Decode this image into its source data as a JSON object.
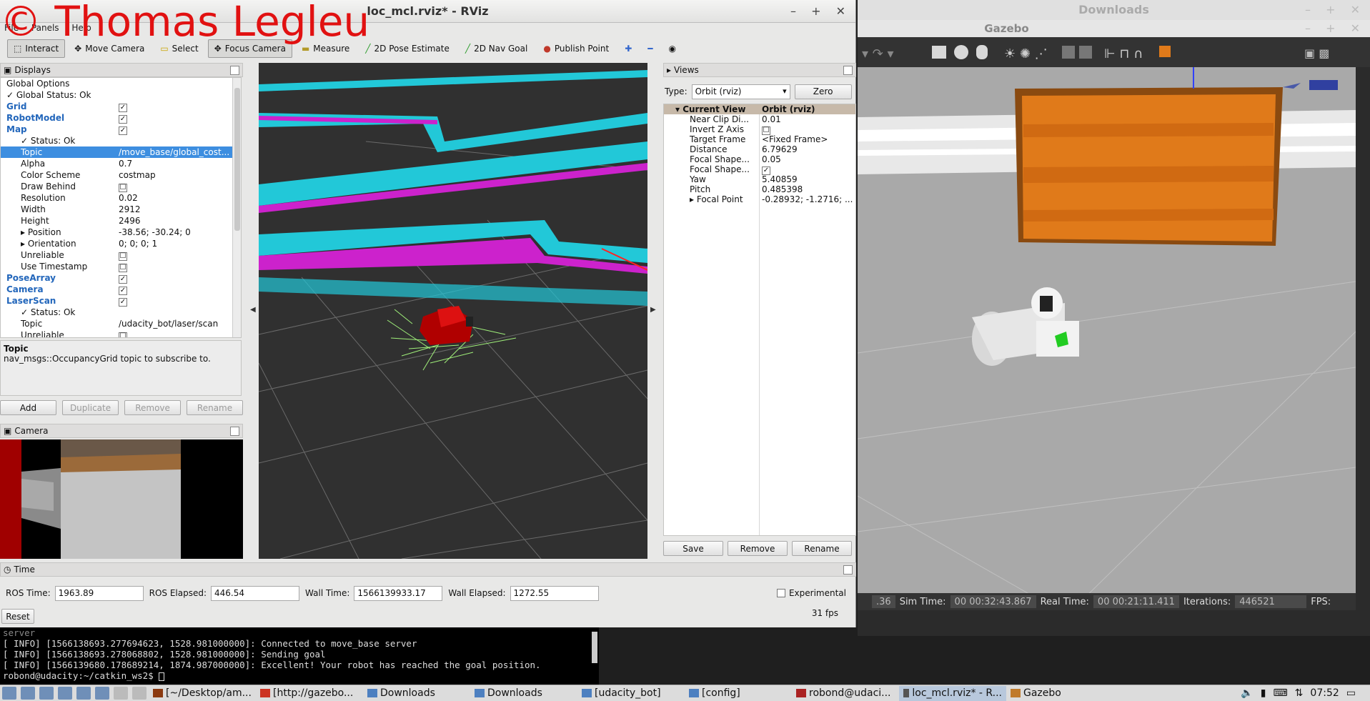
{
  "watermark": "© Thomas Legleu",
  "rviz": {
    "title": "loc_mcl.rviz* - RViz",
    "menu": [
      "File",
      "Panels",
      "Help"
    ],
    "toolbar": [
      {
        "label": "Interact",
        "icon": "cursor-icon"
      },
      {
        "label": "Move Camera",
        "icon": "move-icon"
      },
      {
        "label": "Select",
        "icon": "select-icon"
      },
      {
        "label": "Focus Camera",
        "icon": "focus-icon"
      },
      {
        "label": "Measure",
        "icon": "ruler-icon"
      },
      {
        "label": "2D Pose Estimate",
        "icon": "green-arrow-icon"
      },
      {
        "label": "2D Nav Goal",
        "icon": "green-arrow-icon"
      },
      {
        "label": "Publish Point",
        "icon": "pin-icon"
      }
    ],
    "displays": {
      "title": "Displays",
      "rows": [
        {
          "name": "Global Options",
          "val": "",
          "indent": 1,
          "style": ""
        },
        {
          "name": "Global Status: Ok",
          "val": "",
          "indent": 1,
          "style": "check"
        },
        {
          "name": "Grid",
          "val": "✓",
          "indent": 1,
          "style": "blue"
        },
        {
          "name": "RobotModel",
          "val": "✓",
          "indent": 1,
          "style": "blue"
        },
        {
          "name": "Map",
          "val": "✓",
          "indent": 1,
          "style": "blue"
        },
        {
          "name": "Status: Ok",
          "val": "",
          "indent": 2,
          "style": "check"
        },
        {
          "name": "Topic",
          "val": "/move_base/global_cost...",
          "indent": 2,
          "style": "sel"
        },
        {
          "name": "Alpha",
          "val": "0.7",
          "indent": 2,
          "style": ""
        },
        {
          "name": "Color Scheme",
          "val": "costmap",
          "indent": 2,
          "style": ""
        },
        {
          "name": "Draw Behind",
          "val": "☐",
          "indent": 2,
          "style": ""
        },
        {
          "name": "Resolution",
          "val": "0.02",
          "indent": 2,
          "style": ""
        },
        {
          "name": "Width",
          "val": "2912",
          "indent": 2,
          "style": ""
        },
        {
          "name": "Height",
          "val": "2496",
          "indent": 2,
          "style": ""
        },
        {
          "name": "Position",
          "val": "-38.56; -30.24; 0",
          "indent": 2,
          "style": "expand"
        },
        {
          "name": "Orientation",
          "val": "0; 0; 0; 1",
          "indent": 2,
          "style": "expand"
        },
        {
          "name": "Unreliable",
          "val": "☐",
          "indent": 2,
          "style": ""
        },
        {
          "name": "Use Timestamp",
          "val": "☐",
          "indent": 2,
          "style": ""
        },
        {
          "name": "PoseArray",
          "val": "✓",
          "indent": 1,
          "style": "blue"
        },
        {
          "name": "Camera",
          "val": "✓",
          "indent": 1,
          "style": "blue"
        },
        {
          "name": "LaserScan",
          "val": "✓",
          "indent": 1,
          "style": "blue"
        },
        {
          "name": "Status: Ok",
          "val": "",
          "indent": 2,
          "style": "check"
        },
        {
          "name": "Topic",
          "val": "/udacity_bot/laser/scan",
          "indent": 2,
          "style": ""
        },
        {
          "name": "Unreliable",
          "val": "☐",
          "indent": 2,
          "style": ""
        }
      ],
      "desc_title": "Topic",
      "desc_text": "nav_msgs::OccupancyGrid topic to subscribe to.",
      "buttons": {
        "add": "Add",
        "duplicate": "Duplicate",
        "remove": "Remove",
        "rename": "Rename"
      }
    },
    "camera_panel": {
      "title": "Camera"
    },
    "views": {
      "title": "Views",
      "type_label": "Type:",
      "type_value": "Orbit (rviz)",
      "zero": "Zero",
      "rows": [
        {
          "name": "Current View",
          "val": "Orbit (rviz)",
          "head": true
        },
        {
          "name": "Near Clip Di...",
          "val": "0.01"
        },
        {
          "name": "Invert Z Axis",
          "val": "☐"
        },
        {
          "name": "Target Frame",
          "val": "<Fixed Frame>"
        },
        {
          "name": "Distance",
          "val": "6.79629"
        },
        {
          "name": "Focal Shape...",
          "val": "0.05"
        },
        {
          "name": "Focal Shape...",
          "val": "✓"
        },
        {
          "name": "Yaw",
          "val": "5.40859"
        },
        {
          "name": "Pitch",
          "val": "0.485398"
        },
        {
          "name": "Focal Point",
          "val": "-0.28932; -1.2716; ..."
        }
      ],
      "buttons": {
        "save": "Save",
        "remove": "Remove",
        "rename": "Rename"
      }
    },
    "time": {
      "title": "Time",
      "ros_time_label": "ROS Time:",
      "ros_time": "1963.89",
      "ros_elapsed_label": "ROS Elapsed:",
      "ros_elapsed": "446.54",
      "wall_time_label": "Wall Time:",
      "wall_time": "1566139933.17",
      "wall_elapsed_label": "Wall Elapsed:",
      "wall_elapsed": "1272.55",
      "experimental": "Experimental",
      "reset": "Reset",
      "fps": "31 fps"
    }
  },
  "gazebo": {
    "downloads_title": "Downloads",
    "title": "Gazebo",
    "status": {
      "rtf": ".36",
      "sim_time_label": "Sim Time:",
      "sim_time": "00 00:32:43.867",
      "real_time_label": "Real Time:",
      "real_time": "00 00:21:11.411",
      "iterations_label": "Iterations:",
      "iterations": "446521",
      "fps_label": "FPS:"
    }
  },
  "terminal": {
    "lines": [
      "server",
      "[ INFO] [1566138693.277694623, 1528.981000000]: Connected to move_base server",
      "[ INFO] [1566138693.278068802, 1528.981000000]: Sending goal",
      "[ INFO] [1566139680.178689214, 1874.987000000]: Excellent! Your robot has reached the goal position.",
      "robond@udacity:~/catkin_ws2$ "
    ]
  },
  "taskbar": {
    "tasks": [
      "[~/Desktop/am...",
      "[http://gazebo...",
      "Downloads",
      "Downloads",
      "[udacity_bot]",
      "[config]",
      "robond@udaci...",
      "loc_mcl.rviz* - R...",
      "Gazebo"
    ],
    "clock": "07:52"
  },
  "colors": {
    "selection": "#3d8ee0",
    "costmap_cyan": "#22c8d8",
    "costmap_magenta": "#cc22cc",
    "gazebo_wall": "#e07a1a"
  }
}
